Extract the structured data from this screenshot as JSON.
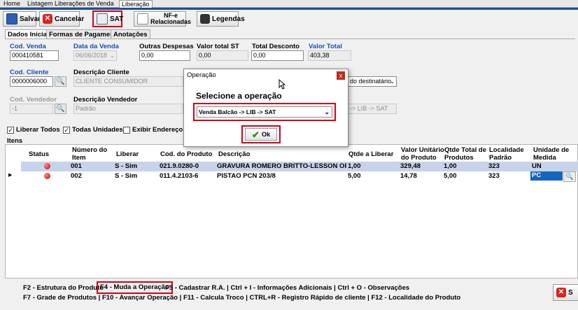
{
  "top_tabs": [
    "Home",
    "Listagem Liberações de Venda",
    "Liberação"
  ],
  "toolbar": {
    "save": "Salvar",
    "cancel": "Cancelar",
    "sat": "SAT",
    "nfe_line1": "NF-e",
    "nfe_line2": "Relacionadas",
    "legends": "Legendas"
  },
  "subtabs": [
    "Dados Iniciais",
    "Formas de Pagamento",
    "Anotações"
  ],
  "form": {
    "cod_venda": {
      "label": "Cod. Venda",
      "value": "000410581"
    },
    "data_venda": {
      "label": "Data da Venda",
      "value": "06/06/2018"
    },
    "outras_despesas": {
      "label": "Outras Despesas",
      "value": "0,00"
    },
    "valor_total_st": {
      "label": "Valor total ST",
      "value": "0,00"
    },
    "total_desconto": {
      "label": "Total Desconto",
      "value": "0,00"
    },
    "valor_total": {
      "label": "Valor Total",
      "value": "403,38"
    },
    "cod_cliente": {
      "label": "Cod. Cliente",
      "value": "0000006000"
    },
    "descricao_cliente": {
      "label": "Descrição Cliente",
      "value": "CLIENTE CONSUMIDOR"
    },
    "destinatario_partial": "do destinatário",
    "cod_vendedor": {
      "label": "Cod. Vendedor",
      "value": "-1"
    },
    "descricao_vendedor": {
      "label": "Descrição Vendedor",
      "value": "Padrão"
    },
    "operation_partial": "-> LIB -> SAT"
  },
  "checkboxes": {
    "liberar_todos": {
      "label": "Liberar Todos",
      "checked": true
    },
    "todas_unidades": {
      "label": "Todas Unidades",
      "checked": true
    },
    "exibir_endereco": {
      "label": "Exibir Endereço",
      "checked": false
    }
  },
  "items_label": "Itens",
  "grid": {
    "headers": {
      "status": "Status",
      "numero": [
        "Número do",
        "Item"
      ],
      "liberar": "Liberar",
      "cod_produto": "Cod. do Produto",
      "descricao": "Descrição",
      "qtde_liberar": "Qtde a Liberar",
      "valor_unitario": [
        "Valor Unitário",
        "do Produto"
      ],
      "qtde_total": [
        "Qtde Total de",
        "Produtos"
      ],
      "localidade": [
        "Localidade",
        "Padrão"
      ],
      "unidade": [
        "Unidade de",
        "Medida"
      ]
    },
    "rows": [
      {
        "numero": "001",
        "liberar": "S - Sim",
        "cod": "021.9.0280-0",
        "descricao": "GRAVURA ROMERO BRITTO-LESSON OF LOVE-...",
        "qtde": "1,00",
        "valor": "329,48",
        "total": "1,00",
        "localidade": "323",
        "unidade": "UN"
      },
      {
        "numero": "002",
        "liberar": "S - Sim",
        "cod": "011.4.2103-6",
        "descricao": "PISTAO PCN 203/8",
        "qtde": "5,00",
        "valor": "14,78",
        "total": "5,00",
        "localidade": "323",
        "unidade": "PC"
      }
    ]
  },
  "footer": {
    "line1": {
      "a": "F2 - Estrutura do Produto",
      "b": "F4 - Muda a Operação",
      "c": "F5 - Cadastrar R.A. | Ctrl + I - Informações Adicionais | Ctrl + O - Observações"
    },
    "line2": "F7 - Grade de Produtos | F10 - Avançar Operação | F11 - Calcula Troco | CTRL+R - Registro Rápido de cliente | F12 - Localidade do Produto",
    "corner_button": "S"
  },
  "dialog": {
    "title": "Operação",
    "close": "x",
    "prompt": "Selecione a operação",
    "select_value": "Venda Balcão -> LIB -> SAT",
    "ok": "Ok"
  },
  "colors": {
    "accent_blue": "#1f4e9c",
    "highlight_red": "#d0021b",
    "selected_row": "#c7d3ea",
    "selected_cell": "#1565c0"
  }
}
